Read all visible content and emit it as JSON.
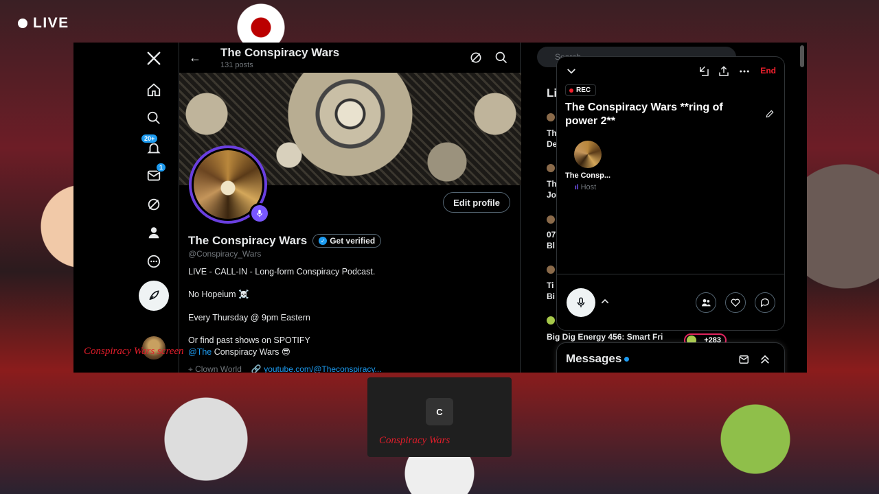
{
  "stream": {
    "live_label": "LIVE"
  },
  "overlay": {
    "caption_left": "Conspiracy Wars screen",
    "caption_tile": "Conspiracy Wars",
    "tile_initial": "C"
  },
  "nav": {
    "notifications_badge": "20+",
    "messages_badge": "1"
  },
  "profile": {
    "header_title": "The Conspiracy Wars",
    "header_posts": "131 posts",
    "edit_profile": "Edit profile",
    "name": "The Conspiracy Wars",
    "get_verified": "Get verified",
    "handle": "@Conspiracy_Wars",
    "bio_line1": "LIVE - CALL-IN - Long-form Conspiracy Podcast.",
    "bio_line2": "No Hopeium ☠️",
    "bio_line3": "Every Thursday @ 9pm Eastern",
    "bio_line4": "Or find past shows on SPOTIFY",
    "bio_mention": "@The",
    "bio_line5_rest": " Conspiracy Wars 😎",
    "location": "Clown World",
    "website": "youtube.com/@Theconspiracy..."
  },
  "sidebar": {
    "search_placeholder": "Search",
    "lives_header": "Li",
    "fragments": [
      "Th",
      "De",
      "Th",
      "Jo",
      "07",
      "Bl",
      "Ti",
      "Bi"
    ],
    "last_item_title": "Big Dig Energy 456: Smart Fri",
    "listener_count": "+283"
  },
  "space": {
    "rec_label": "REC",
    "end_label": "End",
    "title": "The Conspiracy Wars **ring of power 2**",
    "host_name": "The Consp...",
    "host_role": "Host"
  },
  "messages": {
    "title": "Messages"
  },
  "colors": {
    "accent": "#1d9bf0",
    "spaces_purple": "#7856ff",
    "end_red": "#f4212e",
    "overlay_red": "#e11d2a"
  }
}
